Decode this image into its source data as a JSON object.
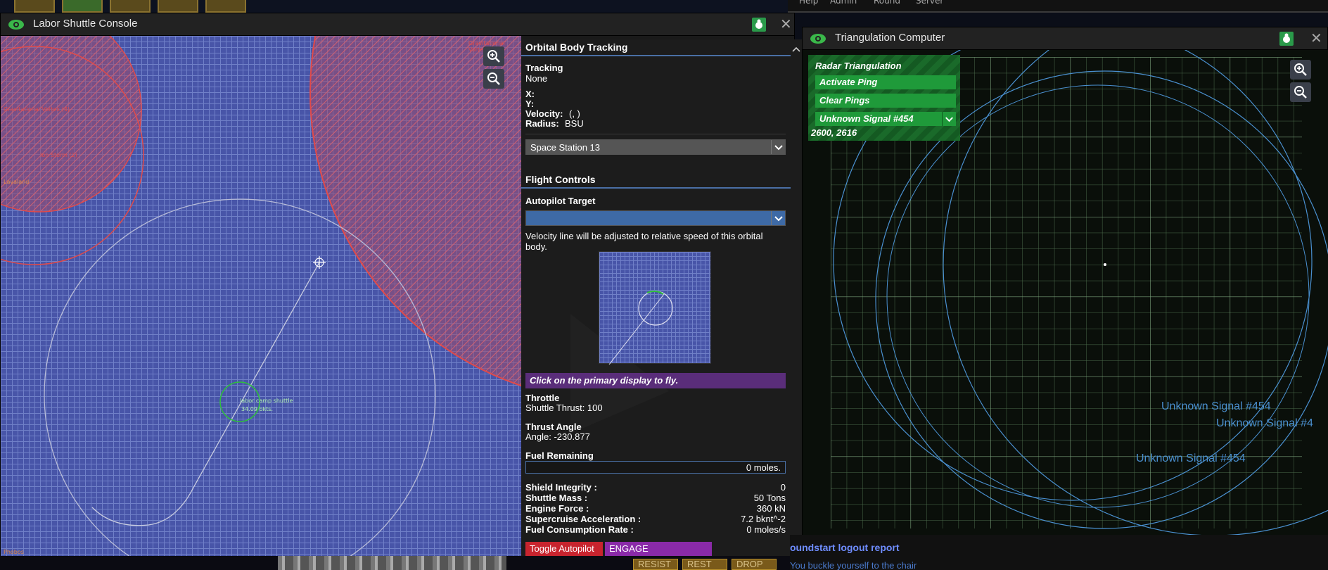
{
  "shuttle_window": {
    "title": "Labor Shuttle Console",
    "map_labels": {
      "vortex_right": "Gravitational Vortex",
      "vortex_left": "Gravitational Vortex (4)",
      "ion_storm": "Ion Storm (2)",
      "lavaland": "Lavaland",
      "shuttle_name": "labor camp shuttle",
      "shuttle_speed": "34.09 bkts.",
      "phobos": "Phobos"
    },
    "orbital": {
      "section_title": "Orbital Body Tracking",
      "tracking_label": "Tracking",
      "tracking_value": "None",
      "x_label": "X:",
      "y_label": "Y:",
      "velocity_label": "Velocity:",
      "velocity_value": "(, )",
      "radius_label": "Radius:",
      "radius_value": "BSU",
      "body_select": "Space Station 13"
    },
    "flight": {
      "section_title": "Flight Controls",
      "autopilot_label": "Autopilot Target",
      "autopilot_select": "",
      "velocity_note_1": "Velocity line will be adjusted to relative speed of this orbital",
      "velocity_note_2": "body.",
      "notice": "Click on the primary display to fly.",
      "throttle_label": "Throttle",
      "throttle_value": "Shuttle Thrust: 100",
      "angle_label": "Thrust Angle",
      "angle_value": "Angle: -230.877",
      "fuel_label": "Fuel Remaining",
      "fuel_value": "0 moles.",
      "fuel_fraction": 0
    },
    "stats": [
      {
        "k": "Shield Integrity :",
        "v": "0"
      },
      {
        "k": "Shuttle Mass :",
        "v": "50 Tons"
      },
      {
        "k": "Engine Force :",
        "v": "360 kN"
      },
      {
        "k": "Supercruise Acceleration :",
        "v": "7.2 bknt^-2"
      },
      {
        "k": "Fuel Consumption Rate :",
        "v": "0 moles/s"
      }
    ],
    "buttons": {
      "autopilot": "Toggle Autopilot",
      "interdictor": "ENGAGE INTERDICTOR"
    }
  },
  "triangulation_window": {
    "title": "Triangulation Computer",
    "radar_title": "Radar Triangulation",
    "activate": "Activate Ping",
    "clear": "Clear Pings",
    "signal_select": "Unknown Signal #454",
    "coords": "2600, 2616",
    "signal_labels": [
      "Unknown Signal #454",
      "Unknown Signal #4",
      "Unknown Signal #454"
    ]
  },
  "chat": {
    "line1": "oundstart logout report",
    "line2": "You buckle yourself to the chair"
  },
  "hud": {
    "resist": "RESIST",
    "rest": "REST",
    "drop": "DROP"
  },
  "menubar": [
    "Help",
    "Admin",
    "Round",
    "Server"
  ],
  "colors": {
    "map_blue": "#4855a8",
    "hazard_red": "#e04a4a",
    "radar_bg": "#0a0f0a",
    "accent_blue": "#4a6fa5",
    "autopilot_red": "#c8242e",
    "interdictor_purple": "#8a2aa8",
    "green_button": "#1f9a3a"
  }
}
